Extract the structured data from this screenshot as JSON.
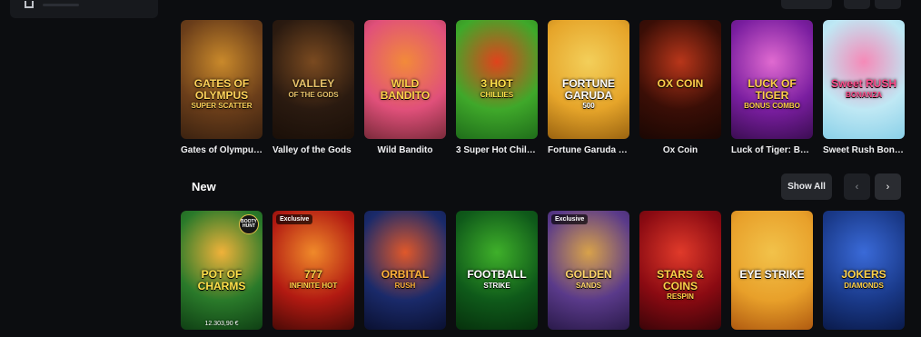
{
  "sections": {
    "popular": {
      "games": [
        {
          "name": "Gates of Olympus Super Scatter",
          "logo": "GATES OF OLYMPUS",
          "sub": "SUPER SCATTER",
          "bg": [
            "#6b3e1a",
            "#c9892b",
            "#3b2210"
          ],
          "logo_color": "#ffd35a"
        },
        {
          "name": "Valley of the Gods",
          "logo": "VALLEY",
          "sub": "OF THE GODS",
          "bg": [
            "#2a1a10",
            "#7a4a20",
            "#1a0f08"
          ],
          "logo_color": "#e8c36a"
        },
        {
          "name": "Wild Bandito",
          "logo": "WILD BANDITO",
          "sub": "",
          "bg": [
            "#e0507a",
            "#f28a3a",
            "#7a2a3a"
          ],
          "logo_color": "#ffd24a"
        },
        {
          "name": "3 Super Hot Chillies",
          "logo": "3 HOT",
          "sub": "CHILLIES",
          "bg": [
            "#3fa82a",
            "#e0431c",
            "#1f6d1a"
          ],
          "logo_color": "#ffe04a"
        },
        {
          "name": "Fortune Garuda 500",
          "logo": "FORTUNE GARUDA",
          "sub": "500",
          "bg": [
            "#e6a52a",
            "#f3cf5a",
            "#9a6310"
          ],
          "logo_color": "#ffffff"
        },
        {
          "name": "Ox Coin",
          "logo": "OX COIN",
          "sub": "",
          "bg": [
            "#3a0e06",
            "#b8361a",
            "#1a0703"
          ],
          "logo_color": "#ffd04a"
        },
        {
          "name": "Luck of Tiger: Bonus Combo",
          "logo": "LUCK OF TIGER",
          "sub": "BONUS COMBO",
          "bg": [
            "#7a1ea0",
            "#e06ad0",
            "#3b0d52"
          ],
          "logo_color": "#ffcf4a"
        },
        {
          "name": "Sweet Rush Bonanza",
          "logo": "Sweet RUSH",
          "sub": "BONANZA",
          "bg": [
            "#bfe8f4",
            "#f58ab8",
            "#8ad0e8"
          ],
          "logo_color": "#ff4c8c"
        }
      ]
    },
    "new": {
      "title": "New",
      "show_all_label": "Show All",
      "prev_label": "‹",
      "next_label": "›",
      "games": [
        {
          "logo": "POT OF CHARMS",
          "sub": "",
          "bg": [
            "#2a7a2a",
            "#f0b23a",
            "#0f3f14"
          ],
          "logo_color": "#ffe04a",
          "badge": "",
          "jackpot": "12.303,90 €",
          "hunt": "BOOTY HUNT"
        },
        {
          "logo": "777",
          "sub": "INFINITE HOT",
          "bg": [
            "#b21a12",
            "#f08a2a",
            "#4a0a06"
          ],
          "logo_color": "#ffd24a",
          "badge": "Exclusive",
          "jackpot": "",
          "hunt": ""
        },
        {
          "logo": "ORBITAL",
          "sub": "RUSH",
          "bg": [
            "#1a2a6a",
            "#e0582a",
            "#0a1030"
          ],
          "logo_color": "#ffb23a",
          "badge": "",
          "jackpot": "",
          "hunt": ""
        },
        {
          "logo": "FOOTBALL",
          "sub": "STRIKE",
          "bg": [
            "#0f5a1a",
            "#3fb02a",
            "#06300c"
          ],
          "logo_color": "#ffffff",
          "badge": "",
          "jackpot": "",
          "hunt": ""
        },
        {
          "logo": "GOLDEN",
          "sub": "SANDS",
          "bg": [
            "#5a3a8a",
            "#d8a24a",
            "#2a1a4a"
          ],
          "logo_color": "#ffd66a",
          "badge": "Exclusive",
          "jackpot": "",
          "hunt": ""
        },
        {
          "logo": "STARS & COINS",
          "sub": "RESPIN",
          "bg": [
            "#8a0a12",
            "#e03a2a",
            "#3a0408"
          ],
          "logo_color": "#ffd24a",
          "badge": "",
          "jackpot": "",
          "hunt": ""
        },
        {
          "logo": "EYE STRIKE",
          "sub": "",
          "bg": [
            "#e8a02a",
            "#f2c24a",
            "#b05a10"
          ],
          "logo_color": "#ffffff",
          "badge": "",
          "jackpot": "",
          "hunt": ""
        },
        {
          "logo": "JOKERS",
          "sub": "DIAMONDS",
          "bg": [
            "#1a3a8a",
            "#3a6ad8",
            "#0a1a4a"
          ],
          "logo_color": "#ffd24a",
          "badge": "",
          "jackpot": "",
          "hunt": ""
        }
      ]
    }
  },
  "labels": {
    "popular_names": [
      "Gates of Olympu…",
      "Valley of the Gods",
      "Wild Bandito",
      "3 Super Hot Chill…",
      "Fortune Garuda …",
      "Ox Coin",
      "Luck of Tiger: B…",
      "Sweet Rush Bon…"
    ]
  }
}
